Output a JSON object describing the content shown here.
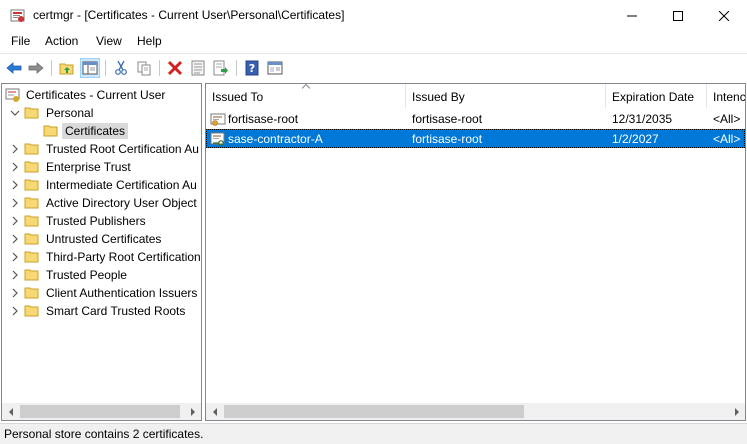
{
  "window": {
    "title": "certmgr - [Certificates - Current User\\Personal\\Certificates]",
    "app_icon": "certmgr-icon"
  },
  "menu": {
    "items": [
      "File",
      "Action",
      "View",
      "Help"
    ]
  },
  "toolbar": {
    "buttons": [
      "back-arrow-icon",
      "forward-arrow-icon",
      "up-folder-icon",
      "show-hide-tree-icon",
      "cut-icon",
      "copy-icon",
      "delete-icon",
      "properties-icon",
      "export-list-icon",
      "help-icon",
      "console-window-icon"
    ]
  },
  "tree": {
    "root": "Certificates - Current User",
    "personal": "Personal",
    "personal_child": "Certificates",
    "stores": [
      "Trusted Root Certification Au",
      "Enterprise Trust",
      "Intermediate Certification Au",
      "Active Directory User Object",
      "Trusted Publishers",
      "Untrusted Certificates",
      "Third-Party Root Certification",
      "Trusted People",
      "Client Authentication Issuers",
      "Smart Card Trusted Roots"
    ]
  },
  "list": {
    "columns": [
      "Issued To",
      "Issued By",
      "Expiration Date",
      "Intenc"
    ],
    "rows": [
      {
        "issued_to": "fortisase-root",
        "issued_by": "fortisase-root",
        "expiration": "12/31/2035",
        "intended": "<All>"
      },
      {
        "issued_to": "sase-contractor-A",
        "issued_by": "fortisase-root",
        "expiration": "1/2/2027",
        "intended": "<All>"
      }
    ],
    "selected_row": 1
  },
  "status": {
    "text": "Personal store contains 2 certificates."
  },
  "colors": {
    "selection": "#0078d7",
    "folder": "#f8d775",
    "tree_selection": "#d9d9d9"
  }
}
